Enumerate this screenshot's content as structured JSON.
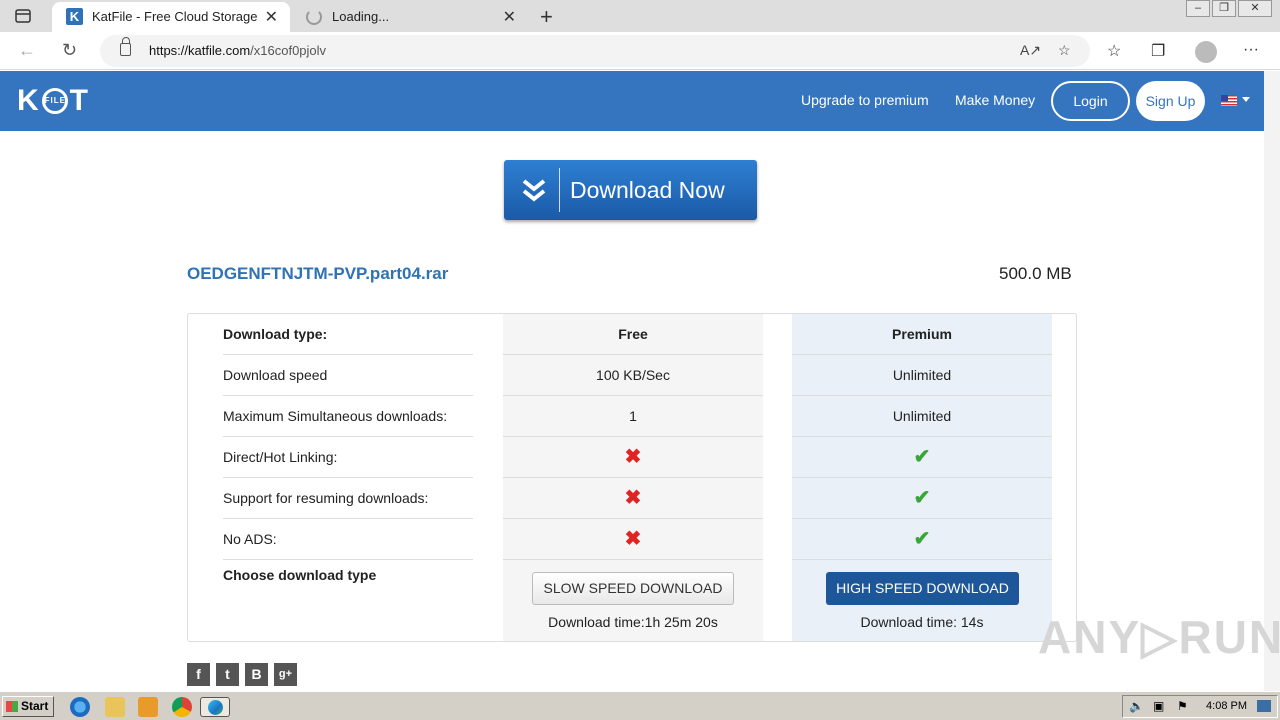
{
  "browser": {
    "tabs": [
      {
        "title": "KatFile - Free Cloud Storage",
        "favicon": "K",
        "active": true
      },
      {
        "title": "Loading...",
        "active": false
      }
    ],
    "url_host": "https://katfile.com",
    "url_path": "/x16cof0pjolv"
  },
  "header": {
    "logo_left": "K",
    "logo_ring": "FILE",
    "logo_right": "T",
    "nav": {
      "upgrade": "Upgrade to premium",
      "make_money": "Make Money",
      "login": "Login",
      "signup": "Sign Up"
    }
  },
  "download_now": "Download Now",
  "file": {
    "name": "OEDGENFTNJTM-PVP.part04.rar",
    "size": "500.0 MB"
  },
  "comparison": {
    "header": {
      "label": "Download type:",
      "free": "Free",
      "premium": "Premium"
    },
    "rows": [
      {
        "label": "Download speed",
        "free": "100 KB/Sec",
        "premium": "Unlimited"
      },
      {
        "label": "Maximum Simultaneous downloads:",
        "free": "1",
        "premium": "Unlimited"
      },
      {
        "label": "Direct/Hot Linking:",
        "free": "✖",
        "premium": "✔"
      },
      {
        "label": "Support for resuming downloads:",
        "free": "✖",
        "premium": "✔"
      },
      {
        "label": "No ADS:",
        "free": "✖",
        "premium": "✔"
      }
    ],
    "choose_label": "Choose download type",
    "slow_button": "SLOW SPEED DOWNLOAD",
    "fast_button": "HIGH SPEED DOWNLOAD",
    "slow_time": "Download time:1h 25m 20s",
    "fast_time": "Download time: 14s"
  },
  "share": [
    "f",
    "t",
    "B",
    "g+"
  ],
  "watermark": "ANY▷RUN",
  "taskbar": {
    "start": "Start",
    "clock": "4:08 PM"
  },
  "colors": {
    "header_blue": "#3575bf",
    "link_blue": "#2f73b6",
    "premium_button": "#1e5799",
    "x_red": "#e02424",
    "check_green": "#3aa63a"
  }
}
